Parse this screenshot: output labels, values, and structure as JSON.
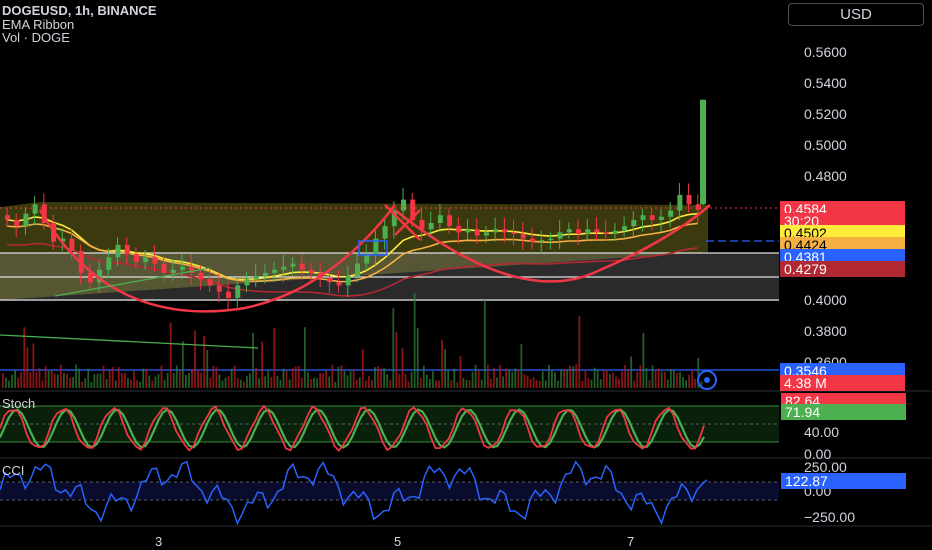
{
  "header": {
    "symbol_line": "DOGEUSD, 1h, BINANCE",
    "indicator1": "EMA Ribbon",
    "indicator2": "Vol · DOGE"
  },
  "currency_button": "USD",
  "price_axis_ticks": [
    "0.5600",
    "0.5400",
    "0.5200",
    "0.5000",
    "0.4800",
    "0.4000",
    "0.3800",
    "0.3600"
  ],
  "price_labels": [
    {
      "text": "0.4584",
      "bg": "#f23645",
      "fg": "#ffffff"
    },
    {
      "text": "30:20",
      "bg": "#f23645",
      "fg": "#ffffff"
    },
    {
      "text": "0.4502",
      "bg": "#ffeb3b",
      "fg": "#000000"
    },
    {
      "text": "0.4424",
      "bg": "#f5b041",
      "fg": "#000000"
    },
    {
      "text": "0.4381",
      "bg": "#2962ff",
      "fg": "#ffffff"
    },
    {
      "text": "0.4279",
      "bg": "#b22833",
      "fg": "#ffffff"
    },
    {
      "text": "0.3546",
      "bg": "#2962ff",
      "fg": "#ffffff"
    },
    {
      "text": "4.38 M",
      "bg": "#f23645",
      "fg": "#ffffff"
    }
  ],
  "stoch": {
    "label": "Stoch",
    "k_value": "82.64",
    "d_value": "71.94",
    "axis_ticks": [
      "40.00",
      "0.00"
    ],
    "k_color": "#f23645",
    "d_color": "#4caf50"
  },
  "cci": {
    "label": "CCI",
    "value": "122.87",
    "axis_ticks": [
      "250.00",
      "0.00",
      "−250.00"
    ],
    "line_color": "#2962ff"
  },
  "x_axis_labels": [
    "3",
    "5",
    "7"
  ],
  "colors": {
    "up": "#4caf50",
    "down": "#f23645",
    "cup_curve": "#f23645",
    "zone_fill": "#6b6a1a",
    "ema_fast": "#ffeb3b",
    "ema_mid": "#f5b041",
    "ema_slow": "#b22833"
  },
  "chart_data": {
    "type": "candlestick",
    "symbol": "DOGEUSD",
    "interval": "1h",
    "exchange": "BINANCE",
    "last_price": 0.4584,
    "bar_countdown": "30:20",
    "ema_values": [
      0.4502,
      0.4424,
      0.4279
    ],
    "horizontal_levels": [
      0.4381,
      0.3546
    ],
    "high": 0.529,
    "price_range": [
      0.35,
      0.575
    ],
    "close_series": [
      0.452,
      0.448,
      0.456,
      0.462,
      0.45,
      0.438,
      0.44,
      0.432,
      0.418,
      0.412,
      0.42,
      0.428,
      0.436,
      0.43,
      0.425,
      0.428,
      0.424,
      0.418,
      0.42,
      0.422,
      0.418,
      0.414,
      0.41,
      0.406,
      0.402,
      0.41,
      0.414,
      0.416,
      0.418,
      0.42,
      0.422,
      0.424,
      0.42,
      0.418,
      0.415,
      0.412,
      0.41,
      0.416,
      0.424,
      0.43,
      0.44,
      0.448,
      0.458,
      0.465,
      0.452,
      0.446,
      0.45,
      0.455,
      0.448,
      0.444,
      0.446,
      0.442,
      0.444,
      0.446,
      0.444,
      0.443,
      0.44,
      0.438,
      0.439,
      0.44,
      0.444,
      0.446,
      0.443,
      0.446,
      0.444,
      0.443,
      0.445,
      0.448,
      0.452,
      0.455,
      0.452,
      0.454,
      0.458,
      0.468,
      0.462,
      0.4584
    ],
    "stoch_k": 82.64,
    "stoch_d": 71.94,
    "cci": 122.87
  }
}
